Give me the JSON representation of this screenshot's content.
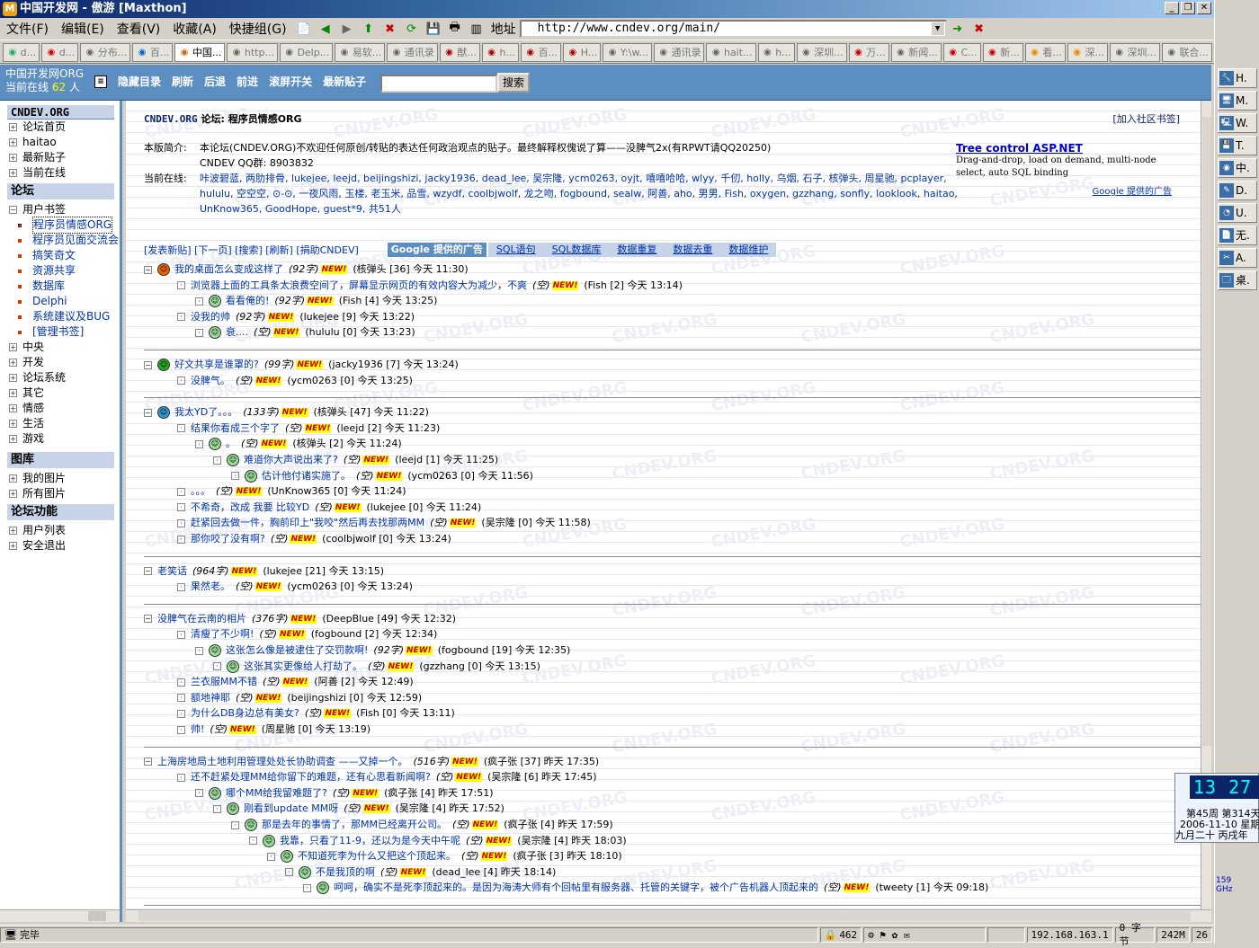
{
  "window": {
    "title": "中国开发网 - 傲游 [Maxthon]",
    "app_icon": "maxthon-icon"
  },
  "menu": [
    "文件(F)",
    "编辑(E)",
    "查看(V)",
    "收藏(A)",
    "快捷组(G)"
  ],
  "address": {
    "label": "地址",
    "url": "http://www.cndev.org/main/"
  },
  "tabs": [
    "d...",
    "d...",
    "分布...",
    "百...",
    "中国...",
    "http...",
    "Delp...",
    "易软...",
    "通讯录",
    "猷...",
    "h...",
    "百...",
    "H...",
    "Y:\\w...",
    "通讯录",
    "hait...",
    "h...",
    "深圳...",
    "万...",
    "新闻...",
    "C...",
    "新...",
    "看...",
    "深...",
    "深圳...",
    "联合..."
  ],
  "header": {
    "site_name": "中国开发网ORG",
    "online_prefix": "当前在线",
    "online_count": "62",
    "online_suffix": "人",
    "nav": [
      "隐藏目录",
      "刷新",
      "后退",
      "前进",
      "滚屏开关",
      "最新贴子"
    ],
    "search_button": "搜索"
  },
  "sidebar": {
    "site": "CNDEV.ORG",
    "top_items": [
      "论坛首页",
      "haitao",
      "最新贴子",
      "当前在线"
    ],
    "forum_head": "论坛",
    "bookmark_group": "用户书签",
    "bookmarks": [
      "程序员情感ORG",
      "程序员见面交流会",
      "搞笑奇文",
      "资源共享",
      "数据库",
      "Delphi",
      "系统建议及BUG",
      "[管理书签]"
    ],
    "categories": [
      "中央",
      "开发",
      "论坛系统",
      "其它",
      "情感",
      "生活",
      "游戏"
    ],
    "gallery_head": "图库",
    "gallery": [
      "我的图片",
      "所有图片"
    ],
    "func_head": "论坛功能",
    "funcs": [
      "用户列表",
      "安全退出"
    ]
  },
  "main": {
    "crumb_site": "CNDEV.ORG",
    "crumb_mid": "论坛:",
    "crumb_board": "程序员情感ORG",
    "join_bookmark": "[加入社区书签]",
    "intro_label": "本版简介:",
    "intro_text": "本论坛(CNDEV.ORG)不欢迎任何原创/转贴的表达任何政治观点的贴子。最终解释权傀说了算——没脾气2x(有RPWT请QQ20250)",
    "qq_group": "CNDEV QQ群: 8903832",
    "online_label": "当前在线:",
    "online_users": "咔波碧蓝, 两肋排骨, lukejee, leejd, beijingshizi, jacky1936, dead_lee, 吴宗隆, ycm0263, oyjt, 嘻嘻哈哈, wlyy, 千仞, holly, 乌烟, 石子, 核弹头, 周星驰, pcplayer, hululu, 空空空, ⊙-⊙, 一夜风雨, 玉楼, 老玉米, 品雪, wzydf, coolbjwolf, 龙之吻, fogbound, sealw, 阿善, aho, 男男, Fish, oxygen, gzzhang, sonfly, looklook, haitao, UnKnow365, GoodHope, guest*9, 共51人",
    "commands": "[发表新贴] [下一页] [搜索] [刷新] [捐助CNDEV]",
    "ad_label": "Google 提供的广告",
    "ad_links": [
      "SQL语句",
      "SQL数据库",
      "数据重复",
      "数据去重",
      "数据维护"
    ],
    "ad": {
      "title": "Tree control ASP.NET",
      "desc": "Drag-and-drop, load on demand, multi-node select, auto SQL binding",
      "by": "Google 提供的广告"
    },
    "new_badge": "NEW!"
  },
  "threads": [
    {
      "posts": [
        {
          "depth": 0,
          "title": "我的桌面怎么变成这样了",
          "len": "(92字)",
          "meta": "(核弹头 [36] 今天 11:30)",
          "face": "angry"
        },
        {
          "depth": 1,
          "title": "浏览器上面的工具条太浪费空间了，屏幕显示网页的有效内容大为减少，不爽",
          "len": "(空)",
          "meta": "(Fish [2] 今天 13:14)"
        },
        {
          "depth": 2,
          "title": "看看俺的!",
          "len": "(92字)",
          "meta": "(Fish [4] 今天 13:25)"
        },
        {
          "depth": 1,
          "title": "没我的帅",
          "len": "(92字)",
          "meta": "(lukejee [9] 今天 13:22)"
        },
        {
          "depth": 2,
          "title": "衰....",
          "len": "(空)",
          "meta": "(hululu [0] 今天 13:23)"
        }
      ]
    },
    {
      "posts": [
        {
          "depth": 0,
          "title": "好文共享是谁罩的?",
          "len": "(99字)",
          "meta": "(jacky1936 [7] 今天 13:24)",
          "face": "smile"
        },
        {
          "depth": 1,
          "title": "没脾气。",
          "len": "(空)",
          "meta": "(ycm0263 [0] 今天 13:25)"
        }
      ]
    },
    {
      "posts": [
        {
          "depth": 0,
          "title": "我太YD了。。。",
          "len": "(133字)",
          "meta": "(核弹头 [47] 今天 11:22)",
          "face": "blue"
        },
        {
          "depth": 1,
          "title": "结果你看成三个字了",
          "len": "(空)",
          "meta": "(leejd [2] 今天 11:23)"
        },
        {
          "depth": 2,
          "title": "。",
          "len": "(空)",
          "meta": "(核弹头 [2] 今天 11:24)"
        },
        {
          "depth": 3,
          "title": "难道你大声说出来了?",
          "len": "(空)",
          "meta": "(leejd [1] 今天 11:25)"
        },
        {
          "depth": 4,
          "title": "估计他付诸实施了。",
          "len": "(空)",
          "meta": "(ycm0263 [0] 今天 11:56)"
        },
        {
          "depth": 1,
          "title": "。。。",
          "len": "(空)",
          "meta": "(UnKnow365 [0] 今天 11:24)"
        },
        {
          "depth": 1,
          "title": "不希奇，改成 我要 比较YD",
          "len": "(空)",
          "meta": "(lukejee [0] 今天 11:24)"
        },
        {
          "depth": 1,
          "title": "赶紧回去做一件，胸前印上\"我咬\"然后再去找那两MM",
          "len": "(空)",
          "meta": "(吴宗隆 [0] 今天 11:58)"
        },
        {
          "depth": 1,
          "title": "那你咬了没有啊?",
          "len": "(空)",
          "meta": "(coolbjwolf [0] 今天 13:24)"
        }
      ]
    },
    {
      "posts": [
        {
          "depth": 0,
          "title": "老笑话",
          "len": "(964字)",
          "meta": "(lukejee [21] 今天 13:15)"
        },
        {
          "depth": 1,
          "title": "果然老。",
          "len": "(空)",
          "meta": "(ycm0263 [0] 今天 13:24)"
        }
      ]
    },
    {
      "posts": [
        {
          "depth": 0,
          "title": "没脾气在云南的相片",
          "len": "(376字)",
          "meta": "(DeepBlue [49] 今天 12:32)"
        },
        {
          "depth": 1,
          "title": "清瘦了不少啊!",
          "len": "(空)",
          "meta": "(fogbound [2] 今天 12:34)"
        },
        {
          "depth": 2,
          "title": "这张怎么像是被逮住了交罚款啊!",
          "len": "(92字)",
          "meta": "(fogbound [19] 今天 12:35)"
        },
        {
          "depth": 3,
          "title": "这张其实更像给人打劫了。",
          "len": "(空)",
          "meta": "(gzzhang [0] 今天 13:15)"
        },
        {
          "depth": 1,
          "title": "兰衣服MM不错",
          "len": "(空)",
          "meta": "(阿善 [2] 今天 12:49)"
        },
        {
          "depth": 1,
          "title": "额地神耶",
          "len": "(空)",
          "meta": "(beijingshizi [0] 今天 12:59)"
        },
        {
          "depth": 1,
          "title": "为什么DB身边总有美女?",
          "len": "(空)",
          "meta": "(Fish [0] 今天 13:11)"
        },
        {
          "depth": 1,
          "title": "帅!",
          "len": "(空)",
          "meta": "(周星驰 [0] 今天 13:19)"
        }
      ]
    },
    {
      "posts": [
        {
          "depth": 0,
          "title": "上海房地局土地利用管理处处长协助调查 ——又掉一个。",
          "len": "(516字)",
          "meta": "(疯子张 [37] 昨天 17:35)"
        },
        {
          "depth": 1,
          "title": "还不赶紧处理MM给你留下的难题，还有心思看新闻啊?",
          "len": "(空)",
          "meta": "(吴宗隆 [6] 昨天 17:45)"
        },
        {
          "depth": 2,
          "title": "哪个MM给我留难题了?",
          "len": "(空)",
          "meta": "(疯子张 [4] 昨天 17:51)"
        },
        {
          "depth": 3,
          "title": "刚看到update MM呀",
          "len": "(空)",
          "meta": "(吴宗隆 [4] 昨天 17:52)"
        },
        {
          "depth": 4,
          "title": "那是去年的事情了，那MM已经离开公司。",
          "len": "(空)",
          "meta": "(疯子张 [4] 昨天 17:59)"
        },
        {
          "depth": 5,
          "title": "我靠，只看了11-9，还以为是今天中午呢",
          "len": "(空)",
          "meta": "(吴宗隆 [4] 昨天 18:03)"
        },
        {
          "depth": 6,
          "title": "不知道死李为什么又把这个顶起来。",
          "len": "(空)",
          "meta": "(疯子张 [3] 昨天 18:10)"
        },
        {
          "depth": 7,
          "title": "不是我顶的啊",
          "len": "(空)",
          "meta": "(dead_lee [4] 昨天 18:14)"
        },
        {
          "depth": 8,
          "title": "呵呵，确实不是死李顶起来的。是因为海涛大师有个回帖里有服务器、托管的关键字，被个广告机器人顶起来的",
          "len": "(空)",
          "meta": "(tweety [1] 今天 09:18)"
        }
      ]
    }
  ],
  "right_panel": [
    "H.",
    "M.",
    "W.",
    "T.",
    "中.",
    "D.",
    "U.",
    "无.",
    "A.",
    "桌."
  ],
  "clock": {
    "time": "13 27",
    "week": "第45周 第314天",
    "date": "2006-11-10 星期五",
    "lunar": "九月二十 丙戌年"
  },
  "tray": {
    "cpu": "159 GHz"
  },
  "status": {
    "text": "完毕",
    "count": "462",
    "ip": "192.168.163.1",
    "bytes": "0 字节",
    "mem": "242M",
    "num": "26"
  },
  "watermark": "CNDEV.ORG",
  "colors": {
    "header_bg": "#5d8ec2",
    "link": "#0033aa",
    "new_badge_bg": "#ffff00",
    "new_badge_fg": "#cc0000"
  }
}
